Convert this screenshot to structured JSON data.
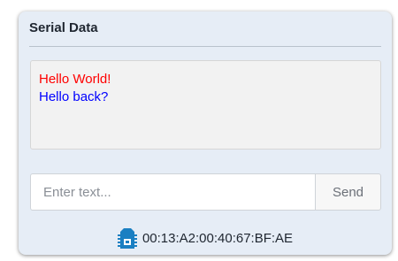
{
  "panel": {
    "title": "Serial Data"
  },
  "log": {
    "lines": [
      {
        "text": "Hello World!",
        "color": "#ff0000"
      },
      {
        "text": "Hello back?",
        "color": "#0000ff"
      }
    ]
  },
  "input": {
    "value": "",
    "placeholder": "Enter text..."
  },
  "send_label": "Send",
  "device": {
    "icon": "xbee-module-icon",
    "icon_color": "#1a7fc2",
    "address": "00:13:A2:00:40:67:BF:AE"
  }
}
